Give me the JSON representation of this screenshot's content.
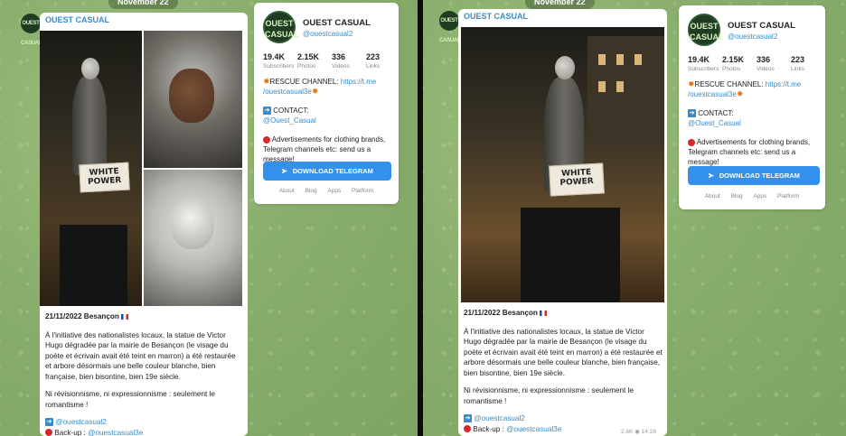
{
  "date_pill": "November 22",
  "channel": {
    "name": "OUEST CASUAL",
    "avatar_text": "OUEST CASUAL",
    "handle": "@ouestcasual2"
  },
  "stats": [
    {
      "value": "19.4K",
      "label": "Subscribers"
    },
    {
      "value": "2.15K",
      "label": "Photos"
    },
    {
      "value": "336",
      "label": "Videos"
    },
    {
      "value": "223",
      "label": "Links"
    }
  ],
  "card": {
    "rescue_label": "RESCUE CHANNEL:",
    "rescue_link_1": "https://t.me",
    "rescue_link_2": "/ouestcasual3e",
    "contact_label": "CONTACT:",
    "contact_handle": "@Ouest_Casual",
    "ads_text": "Advertisements for clothing brands, Telegram channels etc: send us a message!",
    "download_button": "DOWNLOAD TELEGRAM",
    "footer": [
      "About",
      "Blog",
      "Apps",
      "Platform"
    ]
  },
  "post": {
    "date_line": "21/11/2022 Besançon",
    "body": "À l'initiative des nationalistes locaux, la statue de Victor Hugo dégradée par la mairie de Besançon (le visage du poète et écrivain avait été teint en marron) a été restaurée et arbore désormais une belle couleur blanche, bien française, bien bisontine, bien 19e siècle.",
    "slogan": "Ni révisionnisme, ni expressionnisme : seulement le romantisme !",
    "link_1": "@ouestcasual2",
    "backup_label": "Back-up :",
    "link_2": "@ouestcasual3e",
    "views": "2.6K",
    "time": "14:28",
    "sign_line_1": "WHITE",
    "sign_line_2": "POWER"
  },
  "colors": {
    "link": "#3a8cc8",
    "button": "#3390ec",
    "background": "#88ad6c"
  },
  "icons": [
    "arrow-right-icon",
    "red-circle-icon",
    "france-flag-icon",
    "collision-icon",
    "paper-plane-icon",
    "eye-icon"
  ]
}
